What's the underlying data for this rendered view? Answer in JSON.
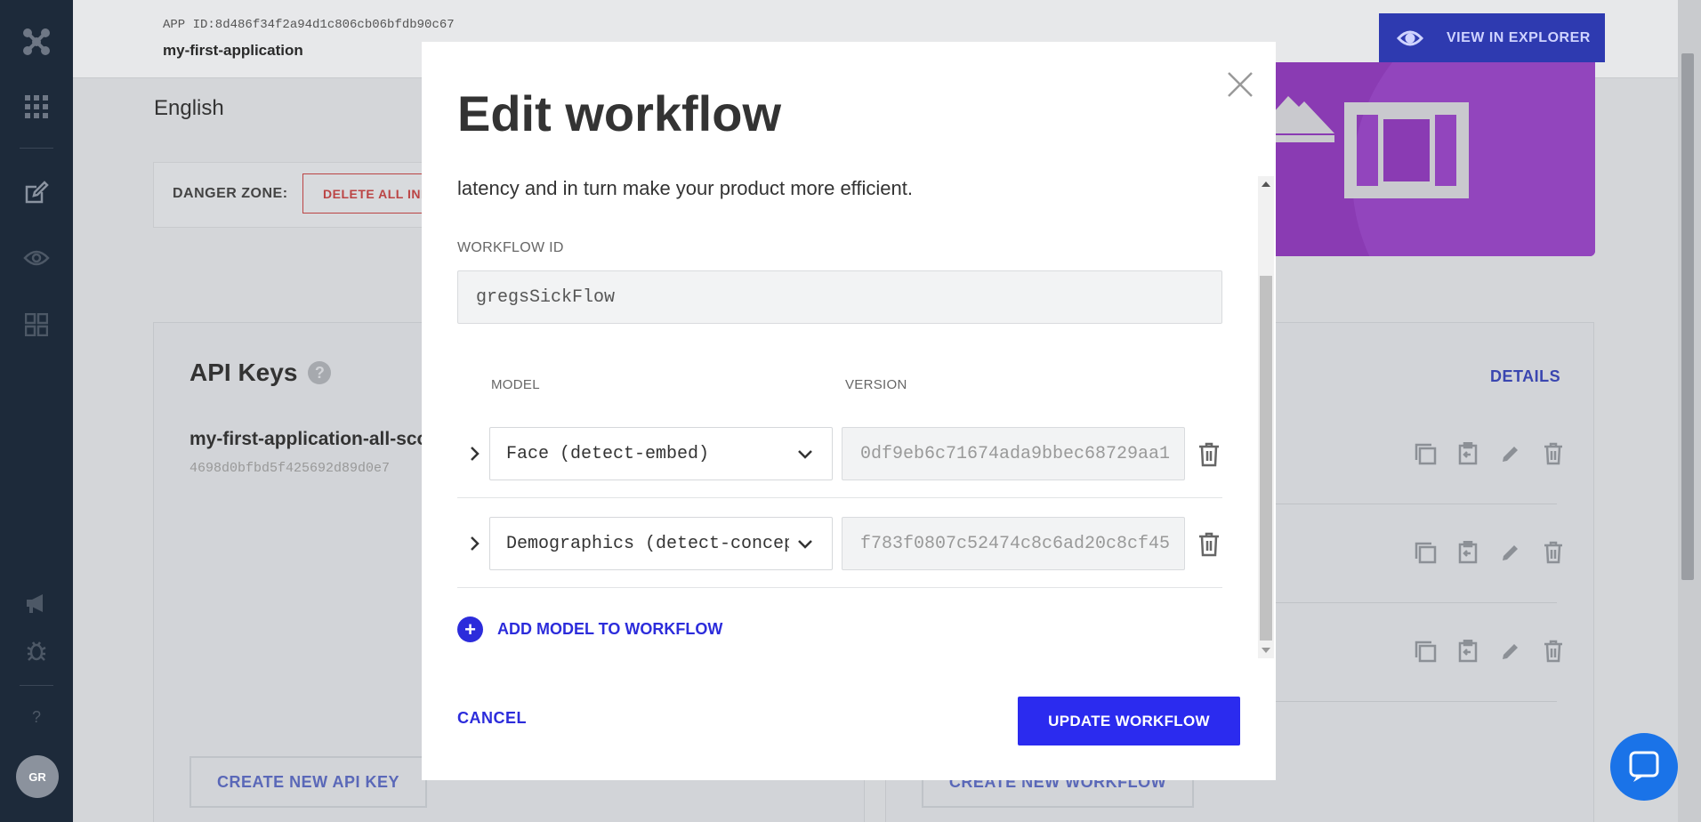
{
  "header": {
    "app_id": "APP ID:8d486f34f2a94d1c806cb06bfdb90c67",
    "app_name": "my-first-application",
    "view_in_explorer": "VIEW IN EXPLORER"
  },
  "sidebar": {
    "items": [
      {
        "icon": "logo-icon"
      },
      {
        "icon": "apps-grid-icon"
      },
      {
        "icon": "edit-icon"
      },
      {
        "icon": "eye-icon"
      },
      {
        "icon": "dashboard-icon"
      },
      {
        "icon": "megaphone-icon"
      },
      {
        "icon": "bug-icon"
      },
      {
        "icon": "help-icon",
        "label": "?"
      }
    ],
    "avatar": "GR"
  },
  "background": {
    "language": "English",
    "danger_zone_label": "DANGER ZONE:",
    "delete_button": "DELETE ALL INPUTS",
    "api_keys_title": "API Keys",
    "help_glyph": "?",
    "key_name": "my-first-application-all-scopes",
    "key_value": "4698d0bfbd5f425692d89d0e7",
    "create_api_key": "CREATE NEW API KEY",
    "details": "DETAILS",
    "create_workflow": "CREATE NEW WORKFLOW"
  },
  "modal": {
    "title": "Edit workflow",
    "description": "latency and in turn make your product more efficient.",
    "workflow_id_label": "WORKFLOW ID",
    "workflow_id_value": "gregsSickFlow",
    "columns": {
      "model": "MODEL",
      "version": "VERSION"
    },
    "rows": [
      {
        "model": "Face (detect-embed)",
        "version": "0df9eb6c71674ada9bbec68729aa1"
      },
      {
        "model": "Demographics (detect-concepts)",
        "version": "f783f0807c52474c8c6ad20c8cf45"
      }
    ],
    "add_model": "ADD MODEL TO WORKFLOW",
    "cancel": "CANCEL",
    "update": "UPDATE WORKFLOW"
  },
  "colors": {
    "primary": "#2b2bef",
    "link": "#2c2cdb",
    "danger": "#bb4444",
    "banner_purple": "#8a3bb3",
    "sidebar_bg": "#1d2a3a"
  }
}
